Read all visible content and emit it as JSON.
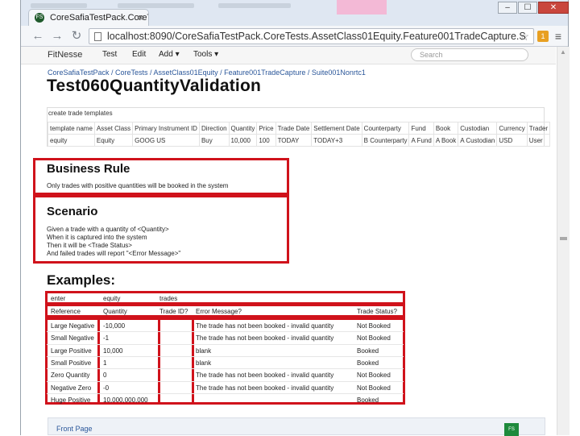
{
  "browser": {
    "tab_title": "CoreSafiaTestPack.CoreTe",
    "tab_icon": "FS",
    "url": "localhost:8090/CoreSafiaTestPack.CoreTests.AssetClass01Equity.Feature001TradeCapture.S",
    "window_controls": [
      "–",
      "☐",
      "✕"
    ],
    "ext_badge": "1"
  },
  "appnav": {
    "brand": "FitNesse",
    "items": [
      "Test",
      "Edit",
      "Add ▾",
      "Tools ▾"
    ],
    "search_placeholder": "Search"
  },
  "breadcrumb": "CoreSafiaTestPack / CoreTests / AssetClass01Equity / Feature001TradeCapture / Suite001Nonrtc1",
  "page_title": "Test060QuantityValidation",
  "template_table": {
    "name": "create trade templates",
    "headers": [
      "template name",
      "Asset Class",
      "Primary Instrument ID",
      "Direction",
      "Quantity",
      "Price",
      "Trade Date",
      "Settlement Date",
      "Counterparty",
      "Fund",
      "Book",
      "Custodian",
      "Currency",
      "Trader"
    ],
    "row": [
      "equity",
      "Equity",
      "GOOG US",
      "Buy",
      "10,000",
      "100",
      "TODAY",
      "TODAY+3",
      "B Counterparty",
      "A Fund",
      "A Book",
      "A Custodian",
      "USD",
      "User"
    ]
  },
  "business_rule": {
    "heading": "Business Rule",
    "text": "Only trades with positive quantities will be booked in the system"
  },
  "scenario": {
    "heading": "Scenario",
    "lines": [
      "Given a trade with a quantity of <Quantity>",
      "When it is captured into the system",
      "Then it will be <Trade Status>",
      "And failed trades will report \"<Error Message>\""
    ]
  },
  "examples": {
    "heading": "Examples:",
    "table_row": [
      "enter",
      "equity",
      "trades"
    ],
    "headers": [
      "Reference",
      "Quantity",
      "Trade ID?",
      "Error Message?",
      "Trade Status?"
    ],
    "rows": [
      [
        "Large Negative",
        "-10,000",
        "",
        "The trade has not been booked - invalid quantity",
        "Not Booked"
      ],
      [
        "Small Negative",
        "-1",
        "",
        "The trade has not been booked - invalid quantity",
        "Not Booked"
      ],
      [
        "Large Positive",
        "10,000",
        "",
        "blank",
        "Booked"
      ],
      [
        "Small Positive",
        "1",
        "",
        "blank",
        "Booked"
      ],
      [
        "Zero Quantity",
        "0",
        "",
        "The trade has not been booked - invalid quantity",
        "Not Booked"
      ],
      [
        "Negative Zero",
        "-0",
        "",
        "The trade has not been booked - invalid quantity",
        "Not Booked"
      ],
      [
        "Huge Positive",
        "10,000,000,000",
        "",
        "",
        "Booked"
      ]
    ]
  },
  "footer": {
    "link": "Front Page",
    "logo": "FS"
  },
  "colors": {
    "highlight_border": "#d0121b",
    "link": "#2b579a",
    "titlebar": "#dfe7f2"
  }
}
